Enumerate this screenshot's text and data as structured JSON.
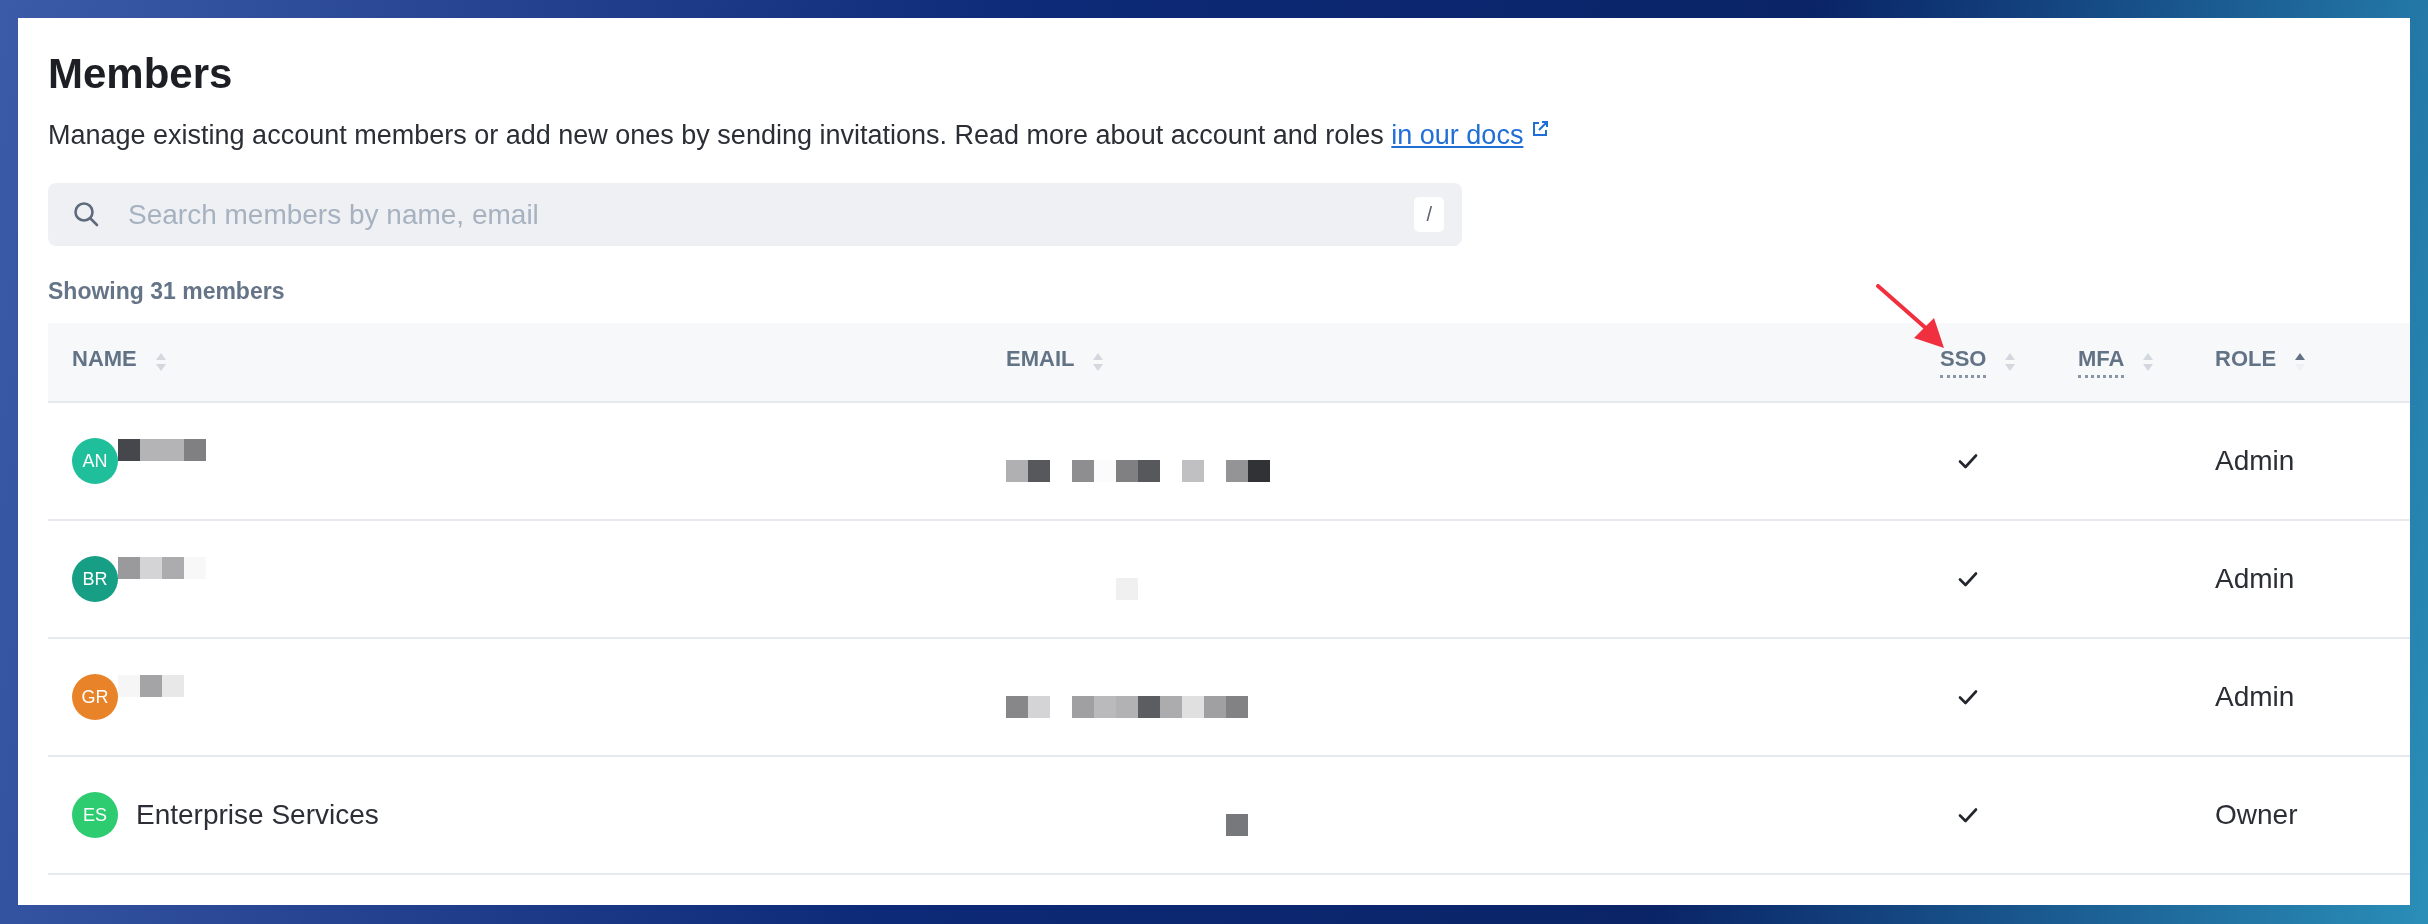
{
  "page": {
    "title": "Members",
    "description": "Manage existing account members or add new ones by sending invitations. Read more about account and roles",
    "docs_link": "in our docs"
  },
  "search": {
    "placeholder": "Search members by name, email",
    "shortcut": "/"
  },
  "summary": "Showing 31 members",
  "table": {
    "columns": [
      {
        "label": "NAME",
        "abbr": false,
        "sorted": false
      },
      {
        "label": "EMAIL",
        "abbr": false,
        "sorted": false
      },
      {
        "label": "SSO",
        "abbr": true,
        "sorted": false
      },
      {
        "label": "MFA",
        "abbr": true,
        "sorted": false
      },
      {
        "label": "ROLE",
        "abbr": false,
        "sorted": true
      }
    ],
    "rows": [
      {
        "initials": "AN",
        "color": "#1fbf9c",
        "name": {
          "kind": "redacted"
        },
        "email": {
          "kind": "redacted"
        },
        "sso": true,
        "mfa": false,
        "role": "Admin"
      },
      {
        "initials": "BR",
        "color": "#179f86",
        "name": {
          "kind": "redacted"
        },
        "email": {
          "kind": "redacted"
        },
        "sso": true,
        "mfa": false,
        "role": "Admin"
      },
      {
        "initials": "GR",
        "color": "#e8832a",
        "name": {
          "kind": "redacted"
        },
        "email": {
          "kind": "redacted"
        },
        "sso": true,
        "mfa": false,
        "role": "Admin"
      },
      {
        "initials": "ES",
        "color": "#2ecc71",
        "name": {
          "kind": "text",
          "text": "Enterprise Services"
        },
        "email": {
          "kind": "redacted"
        },
        "sso": true,
        "mfa": false,
        "role": "Owner"
      }
    ]
  },
  "annotation": {
    "kind": "arrow"
  }
}
